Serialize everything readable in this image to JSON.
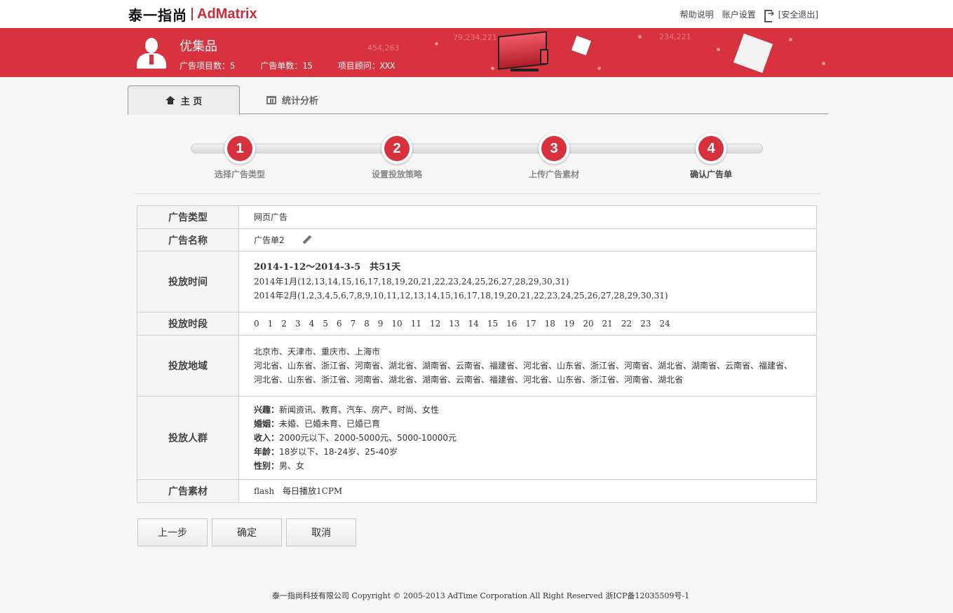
{
  "header": {
    "logo_cn": "泰一指尚",
    "logo_en": "AdMatrix",
    "links": {
      "help": "帮助说明",
      "account": "账户设置",
      "logout": "[安全退出]"
    }
  },
  "banner": {
    "brand": "优集品",
    "stats": {
      "projects": "广告项目数：5",
      "orders": "广告单数：15",
      "advisor": "项目顾问：XXX"
    },
    "deco_numbers": [
      "79,234,221",
      "454,263",
      "234,221"
    ]
  },
  "tabs": [
    {
      "label": "主 页",
      "icon": "home-icon",
      "active": true
    },
    {
      "label": "统计分析",
      "icon": "chart-icon",
      "active": false
    }
  ],
  "steps": [
    {
      "num": "1",
      "label": "选择广告类型"
    },
    {
      "num": "2",
      "label": "设置投放策略"
    },
    {
      "num": "3",
      "label": "上传广告素材"
    },
    {
      "num": "4",
      "label": "确认广告单"
    }
  ],
  "details": {
    "ad_type": {
      "label": "广告类型",
      "value": "网页广告"
    },
    "ad_name": {
      "label": "广告名称",
      "value": "广告单2"
    },
    "schedule": {
      "label": "投放时间",
      "range": "2014-1-12～2014-3-5　共51天",
      "jan": "2014年1月(12,13,14,15,16,17,18,19,20,21,22,23,24,25,26,27,28,29,30,31)",
      "feb": "2014年2月(1,2,3,4,5,6,7,8,9,10,11,12,13,14,15,16,17,18,19,20,21,22,23,24,25,26,27,28,29,30,31)"
    },
    "hours": {
      "label": "投放时段",
      "values": [
        "0",
        "1",
        "2",
        "3",
        "4",
        "5",
        "6",
        "7",
        "8",
        "9",
        "10",
        "11",
        "12",
        "13",
        "14",
        "15",
        "16",
        "17",
        "18",
        "19",
        "20",
        "21",
        "22",
        "23",
        "24"
      ]
    },
    "regions": {
      "label": "投放地域",
      "line1": "北京市、天津市、重庆市、上海市",
      "line2": "河北省、山东省、浙江省、河南省、湖北省、湖南省、云南省、福建省、河北省、山东省、浙江省、河南省、湖北省、湖南省、云南省、福建省、",
      "line3": "河北省、山东省、浙江省、河南省、湖北省、湖南省、云南省、福建省、河北省、山东省、浙江省、河南省、湖北省"
    },
    "audience": {
      "label": "投放人群",
      "interest_k": "兴趣：",
      "interest_v": "新闻资讯、教育、汽车、房产、时尚、女性",
      "marriage_k": "婚姻：",
      "marriage_v": "未婚、已婚未育、已婚已育",
      "income_k": "收入：",
      "income_v": "2000元以下、2000-5000元、5000-10000元",
      "age_k": "年龄：",
      "age_v": "18岁以下、18-24岁、25-40岁",
      "gender_k": "性别：",
      "gender_v": "男、女"
    },
    "material": {
      "label": "广告素材",
      "value": "flash　每日播放1CPM"
    }
  },
  "buttons": {
    "prev": "上一步",
    "confirm": "确定",
    "cancel": "取消"
  },
  "footer": "泰一指尚科技有限公司 Copyright © 2005-2013 AdTime Corporation All Right Reserved 浙ICP备12035509号-1",
  "colors": {
    "brand_red": "#d8323f",
    "step_red": "#d6313d"
  }
}
